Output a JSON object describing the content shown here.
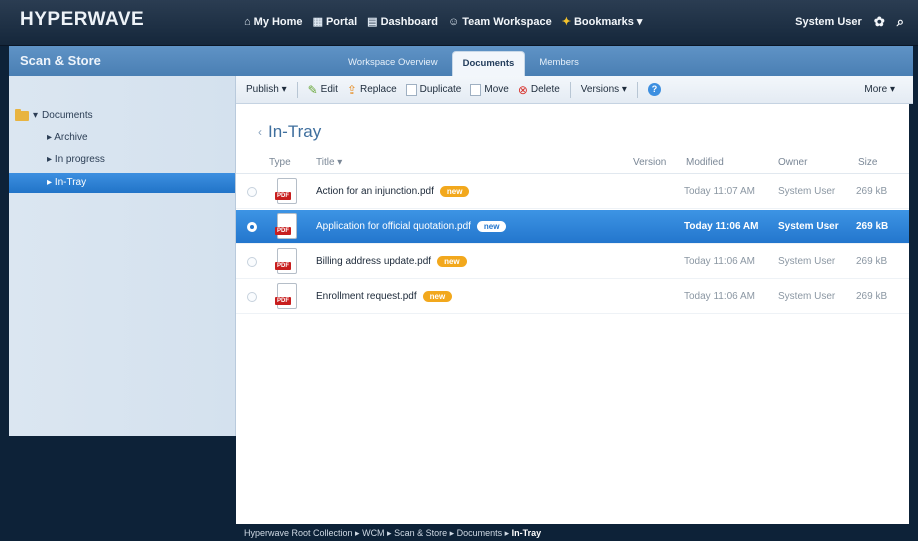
{
  "app": {
    "logo": "HYPERWAVE"
  },
  "topnav": {
    "items": [
      {
        "label": "My Home",
        "icon": "home-icon"
      },
      {
        "label": "Portal",
        "icon": "portal-icon"
      },
      {
        "label": "Dashboard",
        "icon": "dashboard-icon"
      },
      {
        "label": "Team Workspace",
        "icon": "team-icon"
      },
      {
        "label": "Bookmarks ▾",
        "icon": "star-icon"
      }
    ],
    "user": "System User"
  },
  "band": {
    "title": "Scan & Store",
    "tabs": [
      "Workspace Overview",
      "Documents",
      "Members"
    ],
    "active_tab": "Documents"
  },
  "sidebar": {
    "root": "Documents",
    "items": [
      "Archive",
      "In progress",
      "In-Tray"
    ],
    "selected": "In-Tray"
  },
  "toolbar": {
    "publish": "Publish ▾",
    "edit": "Edit",
    "replace": "Replace",
    "duplicate": "Duplicate",
    "move": "Move",
    "delete": "Delete",
    "versions": "Versions ▾",
    "more": "More ▾"
  },
  "content": {
    "title": "In-Tray",
    "columns": {
      "type": "Type",
      "title": "Title ▾",
      "version": "Version",
      "modified": "Modified",
      "owner": "Owner",
      "size": "Size"
    },
    "rows": [
      {
        "title": "Action for an injunction.pdf",
        "badge": "new",
        "modified": "Today 11:07 AM",
        "owner": "System User",
        "size": "269 kB",
        "selected": false
      },
      {
        "title": "Application for official quotation.pdf",
        "badge": "new",
        "modified": "Today 11:06 AM",
        "owner": "System User",
        "size": "269 kB",
        "selected": true
      },
      {
        "title": "Billing address update.pdf",
        "badge": "new",
        "modified": "Today 11:06 AM",
        "owner": "System User",
        "size": "269 kB",
        "selected": false
      },
      {
        "title": "Enrollment request.pdf",
        "badge": "new",
        "modified": "Today 11:06 AM",
        "owner": "System User",
        "size": "269 kB",
        "selected": false
      }
    ],
    "file_type_label": "PDF"
  },
  "breadcrumb": {
    "text": "Hyperwave Root Collection ▸ WCM ▸ Scan & Store ▸ Documents ▸ ",
    "current": "In-Tray"
  }
}
